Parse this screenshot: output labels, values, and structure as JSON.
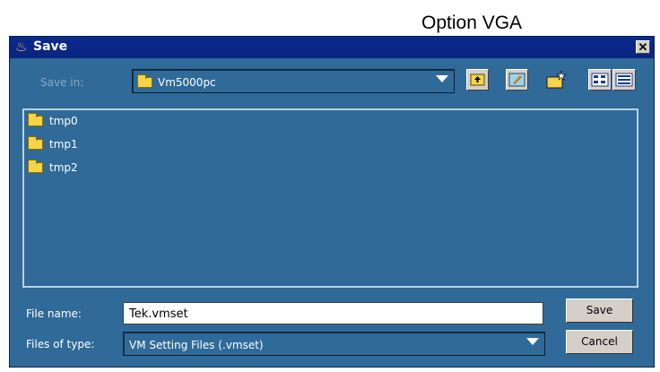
{
  "caption": "Option VGA",
  "window": {
    "title": "Save",
    "close_glyph": "✕"
  },
  "save_in": {
    "label": "Save in:",
    "value": "Vm5000pc",
    "toolbar": [
      "up-one-level-icon",
      "desktop-icon",
      "new-folder-icon",
      "list-view-icon",
      "details-view-icon"
    ]
  },
  "files": [
    {
      "name": "tmp0",
      "icon": "folder-icon"
    },
    {
      "name": "tmp1",
      "icon": "folder-icon"
    },
    {
      "name": "tmp2",
      "icon": "folder-icon"
    }
  ],
  "file_name": {
    "label": "File name:",
    "value": "Tek.vmset"
  },
  "file_type": {
    "label": "Files of type:",
    "value": "VM Setting Files (.vmset)"
  },
  "buttons": {
    "save": "Save",
    "cancel": "Cancel"
  }
}
